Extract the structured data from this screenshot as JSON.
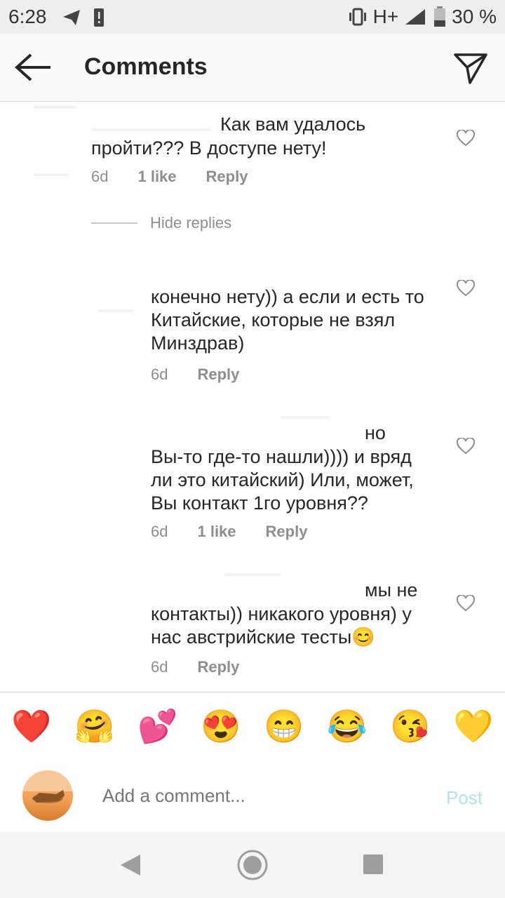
{
  "status": {
    "time": "6:28",
    "network": "H+",
    "battery": "30 %"
  },
  "header": {
    "title": "Comments"
  },
  "comments": [
    {
      "text_tail": "Как вам удалось",
      "text_body": "пройти??? В доступе нету!",
      "time": "6d",
      "likes": "1 like",
      "reply": "Reply"
    },
    {
      "text": "конечно нету)) а если и есть то Китайские, которые не взял Минздрав)",
      "time": "6d",
      "reply": "Reply"
    },
    {
      "text_tail": "но",
      "text_body": "Вы-то где-то нашли)))) и вряд ли это китайский) Или, может, Вы контакт 1го уровня??",
      "time": "6d",
      "likes": "1 like",
      "reply": "Reply"
    },
    {
      "text_tail": "мы не",
      "text_body": "контакты)) никакого уровня) у нас австрийские тесты😊",
      "time": "6d",
      "reply": "Reply"
    }
  ],
  "thread": {
    "hide_replies": "Hide replies"
  },
  "emoji_bar": [
    "❤️",
    "🤗",
    "💕",
    "😍",
    "😁",
    "😂",
    "😘",
    "💛"
  ],
  "compose": {
    "placeholder": "Add a comment...",
    "post": "Post"
  }
}
